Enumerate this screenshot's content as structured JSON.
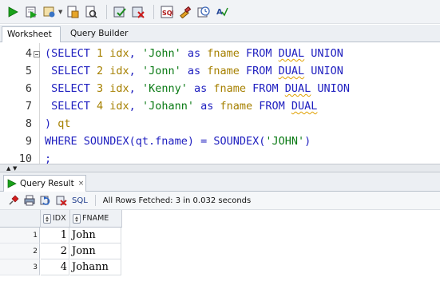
{
  "toolbar": {
    "buttons": [
      "run-statement-icon",
      "run-script-icon",
      "autotrace-icon",
      "explain-plan-icon",
      "sql-tuning-icon",
      "commit-icon",
      "rollback-icon",
      "unshared-sql-icon",
      "clear-icon",
      "history-icon",
      "format-icon"
    ]
  },
  "tabs": {
    "worksheet": "Worksheet",
    "query_builder": "Query Builder"
  },
  "editor": {
    "lines": [
      {
        "num": "4",
        "tokens": [
          {
            "t": "(SELECT ",
            "c": "k"
          },
          {
            "t": "1 idx",
            "c": "o"
          },
          {
            "t": ", ",
            "c": "p"
          },
          {
            "t": "'John'",
            "c": "s"
          },
          {
            "t": " as ",
            "c": "k"
          },
          {
            "t": "fname",
            "c": "o"
          },
          {
            "t": " FROM ",
            "c": "k"
          },
          {
            "t": "DUAL",
            "c": "k sq"
          },
          {
            "t": " UNION",
            "c": "k"
          }
        ]
      },
      {
        "num": "5",
        "tokens": [
          {
            "t": " SELECT ",
            "c": "k"
          },
          {
            "t": "2 idx",
            "c": "o"
          },
          {
            "t": ", ",
            "c": "p"
          },
          {
            "t": "'Jonn'",
            "c": "s"
          },
          {
            "t": " as ",
            "c": "k"
          },
          {
            "t": "fname",
            "c": "o"
          },
          {
            "t": " FROM ",
            "c": "k"
          },
          {
            "t": "DUAL",
            "c": "k sq"
          },
          {
            "t": " UNION",
            "c": "k"
          }
        ]
      },
      {
        "num": "6",
        "tokens": [
          {
            "t": " SELECT ",
            "c": "k"
          },
          {
            "t": "3 idx",
            "c": "o"
          },
          {
            "t": ", ",
            "c": "p"
          },
          {
            "t": "'Kenny'",
            "c": "s"
          },
          {
            "t": " as ",
            "c": "k"
          },
          {
            "t": "fname",
            "c": "o"
          },
          {
            "t": " FROM ",
            "c": "k"
          },
          {
            "t": "DUAL",
            "c": "k sq"
          },
          {
            "t": " UNION",
            "c": "k"
          }
        ]
      },
      {
        "num": "7",
        "tokens": [
          {
            "t": " SELECT ",
            "c": "k"
          },
          {
            "t": "4 idx",
            "c": "o"
          },
          {
            "t": ", ",
            "c": "p"
          },
          {
            "t": "'Johann'",
            "c": "s"
          },
          {
            "t": " as ",
            "c": "k"
          },
          {
            "t": "fname",
            "c": "o"
          },
          {
            "t": " FROM ",
            "c": "k"
          },
          {
            "t": "DUAL",
            "c": "k sq"
          }
        ]
      },
      {
        "num": "8",
        "tokens": [
          {
            "t": ") ",
            "c": "k"
          },
          {
            "t": "qt",
            "c": "o"
          }
        ]
      },
      {
        "num": "9",
        "tokens": [
          {
            "t": "WHERE SOUNDEX(",
            "c": "k"
          },
          {
            "t": "qt.fname",
            "c": "k"
          },
          {
            "t": ") = SOUNDEX(",
            "c": "k"
          },
          {
            "t": "'JOHN'",
            "c": "s"
          },
          {
            "t": ")",
            "c": "k"
          }
        ]
      },
      {
        "num": "10",
        "tokens": [
          {
            "t": ";",
            "c": "k"
          }
        ]
      }
    ]
  },
  "result_tab": {
    "label": "Query Result",
    "close": "×"
  },
  "result_toolbar": {
    "sql_label": "SQL",
    "status": "All Rows Fetched: 3 in 0.032 seconds"
  },
  "grid": {
    "columns": [
      "IDX",
      "FNAME"
    ],
    "rows": [
      {
        "rownum": "1",
        "idx": "1",
        "fname": "John"
      },
      {
        "rownum": "2",
        "idx": "2",
        "fname": "Jonn"
      },
      {
        "rownum": "3",
        "idx": "4",
        "fname": "Johann"
      }
    ]
  },
  "colors": {
    "keyword": "#2020c0",
    "string": "#0a7a14",
    "identifier": "#a68000"
  }
}
